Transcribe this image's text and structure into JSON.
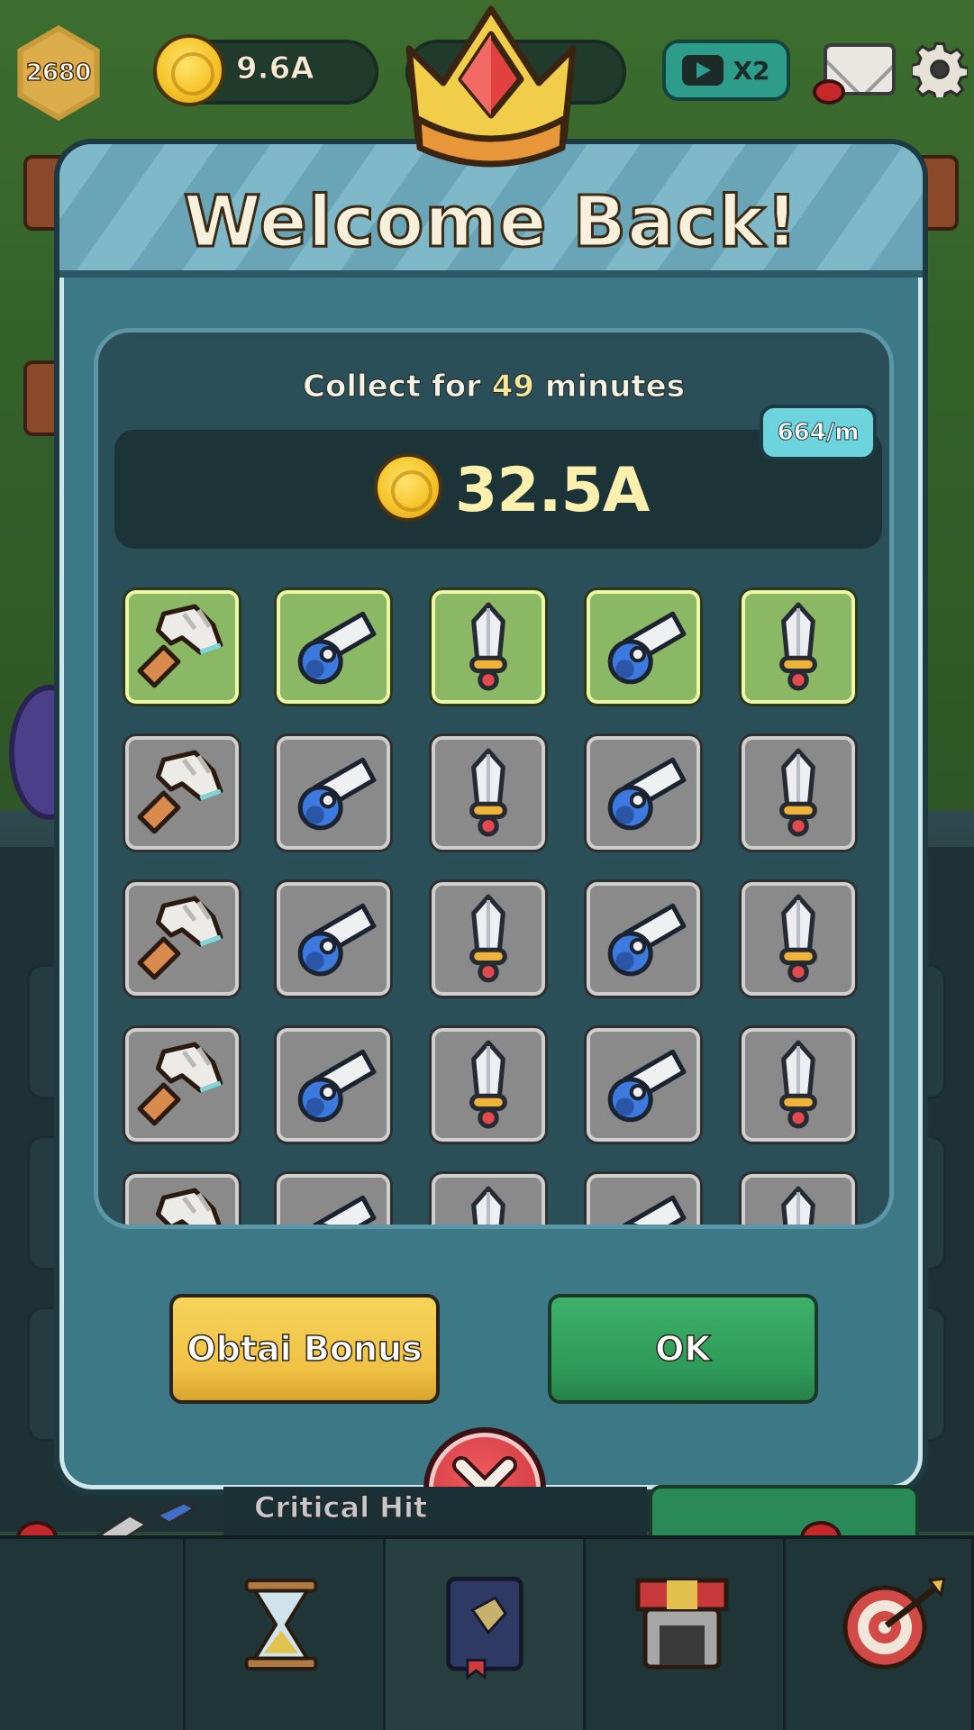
{
  "hud": {
    "gems": "2680",
    "coins": "9.6A",
    "x2_label": "X2"
  },
  "modal": {
    "title": "Welcome Back!",
    "collect": {
      "prefix": "Collect for",
      "number": "49",
      "suffix": "minutes"
    },
    "amount": "32.5A",
    "rate": "664/m",
    "items": [
      [
        "hammer-icon",
        "cannon-icon",
        "sword-icon",
        "cannon-icon",
        "sword-icon"
      ],
      [
        "hammer-icon",
        "cannon-icon",
        "sword-icon",
        "cannon-icon",
        "sword-icon"
      ],
      [
        "hammer-icon",
        "cannon-icon",
        "sword-icon",
        "cannon-icon",
        "sword-icon"
      ],
      [
        "hammer-icon",
        "cannon-icon",
        "sword-icon",
        "cannon-icon",
        "sword-icon"
      ],
      [
        "hammer-icon",
        "cannon-icon",
        "sword-icon",
        "cannon-icon",
        "sword-icon"
      ]
    ],
    "highlighted_row": 0,
    "buttons": {
      "bonus": "Obtai Bonus",
      "ok": "OK"
    }
  },
  "background": {
    "skill_label": "Critical Hit"
  },
  "nav": {
    "items": [
      "hourglass-icon",
      "book-icon",
      "shop-icon",
      "target-icon"
    ],
    "active_index": 1
  },
  "colors": {
    "modal": "#3d7886",
    "panel": "#2a4f58",
    "highlight_tile": "#8ab865",
    "ok_button": "#2f9a59",
    "bonus_button": "#f0c245",
    "close_button": "#d43f45"
  }
}
